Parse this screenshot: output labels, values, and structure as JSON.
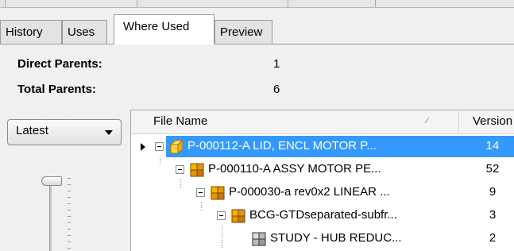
{
  "tabs": [
    {
      "label": "History"
    },
    {
      "label": "Uses"
    },
    {
      "label": "Where Used"
    },
    {
      "label": "Preview"
    }
  ],
  "summary": {
    "direct_parents_label": "Direct Parents:",
    "direct_parents_value": "1",
    "total_parents_label": "Total Parents:",
    "total_parents_value": "6"
  },
  "version_select": {
    "selected": "Latest"
  },
  "grid": {
    "columns": {
      "file_name": "File Name",
      "version": "Version"
    },
    "rows": [
      {
        "file_name": "P-000112-A LID, ENCL MOTOR P...",
        "version": "14",
        "icon": "part-icon",
        "selected": true
      },
      {
        "file_name": "P-000110-A ASSY MOTOR PE...",
        "version": "52",
        "icon": "assembly-icon"
      },
      {
        "file_name": "P-000030-a rev0x2 LINEAR ...",
        "version": "9",
        "icon": "assembly-icon"
      },
      {
        "file_name": "BCG-GTDseparated-subfr...",
        "version": "3",
        "icon": "assembly-icon"
      },
      {
        "file_name": "STUDY - HUB REDUC...",
        "version": "2",
        "icon": "assembly-icon"
      }
    ]
  },
  "colors": {
    "selection": "#3399ff",
    "assembly_icon": "#e8a000"
  }
}
